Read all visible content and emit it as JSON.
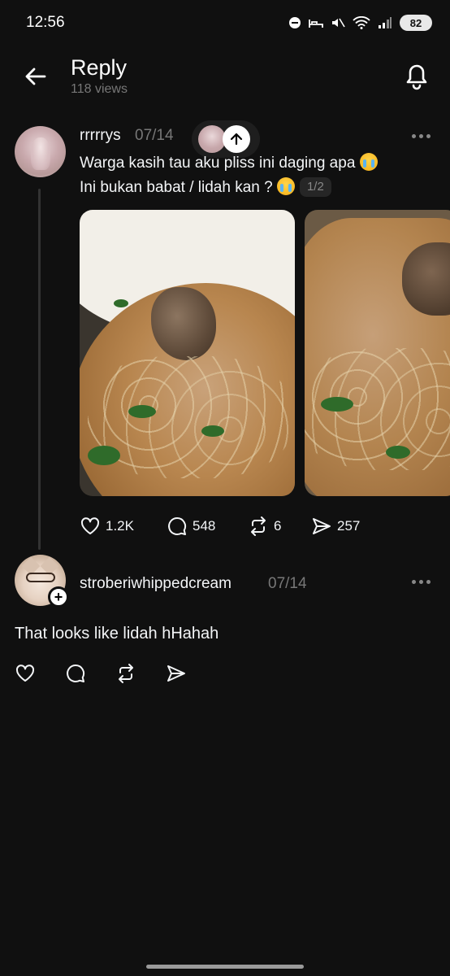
{
  "status_bar": {
    "time": "12:56",
    "battery": "82"
  },
  "header": {
    "title": "Reply",
    "views": "118 views"
  },
  "post": {
    "username": "rrrrrys",
    "date": "07/14",
    "text_line1": "Warga kasih tau aku pliss ini daging apa",
    "text_line2": "Ini bukan babat / lidah kan ?",
    "image_counter": "1/2",
    "likes": "1.2K",
    "comments": "548",
    "reposts": "6",
    "shares": "257"
  },
  "reply": {
    "username": "stroberiwhippedcream",
    "date": "07/14",
    "text": "That looks like lidah hHahah"
  },
  "icons": {
    "back": "arrow-left-icon",
    "bell": "bell-icon",
    "more": "more-horizontal-icon",
    "like": "heart-icon",
    "comment": "comment-icon",
    "repost": "repost-icon",
    "share": "send-icon"
  }
}
